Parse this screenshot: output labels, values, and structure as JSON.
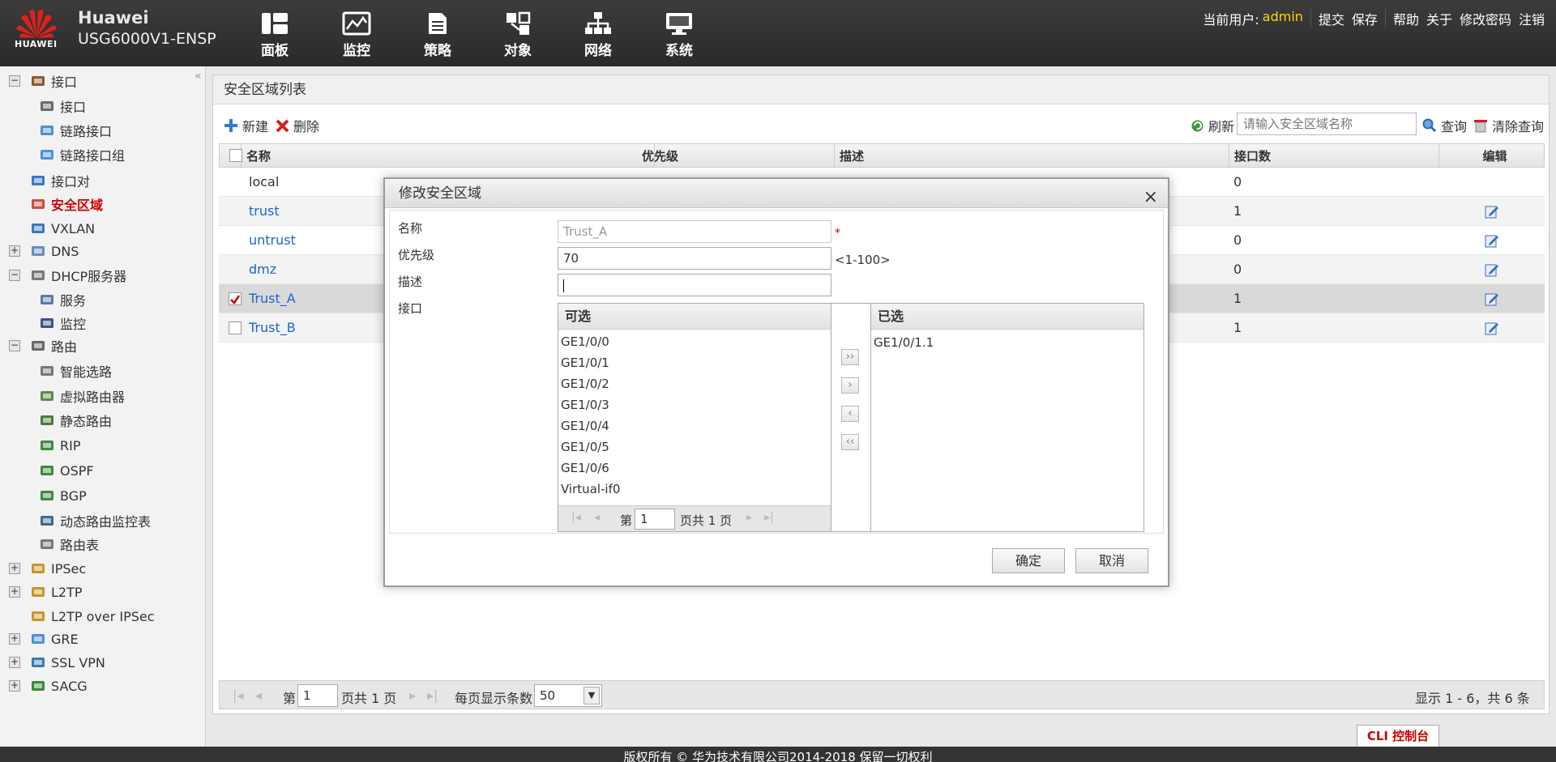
{
  "header": {
    "logo_text": "HUAWEI",
    "brand": "Huawei",
    "model": "USG6000V1-ENSP",
    "nav": [
      {
        "label": "面板",
        "icon": "dashboard-icon"
      },
      {
        "label": "监控",
        "icon": "monitor-icon"
      },
      {
        "label": "策略",
        "icon": "policy-icon"
      },
      {
        "label": "对象",
        "icon": "object-icon"
      },
      {
        "label": "网络",
        "icon": "network-icon"
      },
      {
        "label": "系统",
        "icon": "system-icon"
      }
    ],
    "user_label": "当前用户:",
    "username": "admin",
    "links": [
      "提交",
      "保存",
      "帮助",
      "关于",
      "修改密码",
      "注销"
    ]
  },
  "sidebar": {
    "items": [
      {
        "label": "接口",
        "level": 0,
        "expander": "−"
      },
      {
        "label": "接口",
        "level": 1
      },
      {
        "label": "链路接口",
        "level": 1
      },
      {
        "label": "链路接口组",
        "level": 1
      },
      {
        "label": "接口对",
        "level": 0
      },
      {
        "label": "安全区域",
        "level": 0,
        "active": true
      },
      {
        "label": "VXLAN",
        "level": 0
      },
      {
        "label": "DNS",
        "level": 0,
        "expander": "+"
      },
      {
        "label": "DHCP服务器",
        "level": 0,
        "expander": "−"
      },
      {
        "label": "服务",
        "level": 1
      },
      {
        "label": "监控",
        "level": 1
      },
      {
        "label": "路由",
        "level": 0,
        "expander": "−"
      },
      {
        "label": "智能选路",
        "level": 1
      },
      {
        "label": "虚拟路由器",
        "level": 1
      },
      {
        "label": "静态路由",
        "level": 1
      },
      {
        "label": "RIP",
        "level": 1
      },
      {
        "label": "OSPF",
        "level": 1
      },
      {
        "label": "BGP",
        "level": 1
      },
      {
        "label": "动态路由监控表",
        "level": 1
      },
      {
        "label": "路由表",
        "level": 1
      },
      {
        "label": "IPSec",
        "level": 0,
        "expander": "+"
      },
      {
        "label": "L2TP",
        "level": 0,
        "expander": "+"
      },
      {
        "label": "L2TP over IPSec",
        "level": 0
      },
      {
        "label": "GRE",
        "level": 0,
        "expander": "+"
      },
      {
        "label": "SSL VPN",
        "level": 0,
        "expander": "+"
      },
      {
        "label": "SACG",
        "level": 0,
        "expander": "+"
      }
    ]
  },
  "main": {
    "title": "安全区域列表",
    "toolbar": {
      "new_label": "新建",
      "delete_label": "删除",
      "refresh_label": "刷新",
      "search_placeholder": "请输入安全区域名称",
      "query_label": "查询",
      "clear_label": "清除查询"
    },
    "columns": [
      "名称",
      "优先级",
      "描述",
      "接口数",
      "编辑"
    ],
    "rows": [
      {
        "name": "local",
        "count": "0",
        "link": false,
        "checkbox": false,
        "editable": false
      },
      {
        "name": "trust",
        "count": "1",
        "link": true,
        "checkbox": false,
        "editable": true
      },
      {
        "name": "untrust",
        "count": "0",
        "link": true,
        "checkbox": false,
        "editable": true
      },
      {
        "name": "dmz",
        "count": "0",
        "link": true,
        "checkbox": false,
        "editable": true
      },
      {
        "name": "Trust_A",
        "count": "1",
        "link": true,
        "checkbox": true,
        "checked": true,
        "editable": true
      },
      {
        "name": "Trust_B",
        "count": "1",
        "link": true,
        "checkbox": true,
        "checked": false,
        "editable": true
      }
    ],
    "pager": {
      "page_prefix": "第",
      "page": "1",
      "page_suffix": "页共 1 页",
      "per_page_label": "每页显示条数",
      "per_page": "50",
      "summary": "显示 1 - 6，共 6 条"
    }
  },
  "dialog": {
    "title": "修改安全区域",
    "close": "×",
    "fields": {
      "name_label": "名称",
      "name_value": "Trust_A",
      "required_mark": "*",
      "priority_label": "优先级",
      "priority_value": "70",
      "priority_range": "<1-100>",
      "desc_label": "描述",
      "desc_value": "",
      "iface_label": "接口"
    },
    "available": {
      "header": "可选",
      "items": [
        "GE1/0/0",
        "GE1/0/1",
        "GE1/0/2",
        "GE1/0/3",
        "GE1/0/4",
        "GE1/0/5",
        "GE1/0/6",
        "Virtual-if0"
      ],
      "page_prefix": "第",
      "page": "1",
      "page_suffix": "页共 1 页"
    },
    "selected": {
      "header": "已选",
      "items": [
        "GE1/0/1.1"
      ]
    },
    "move_buttons": [
      "››",
      "›",
      "‹",
      "‹‹"
    ],
    "ok_label": "确定",
    "cancel_label": "取消"
  },
  "footer": {
    "copyright": "版权所有 © 华为技术有限公司2014-2018    保留一切权利"
  },
  "cli_button": "CLI 控制台",
  "colors": {
    "active_menu": "#cc0000",
    "link": "#1a66cc",
    "username": "#ffd800"
  }
}
